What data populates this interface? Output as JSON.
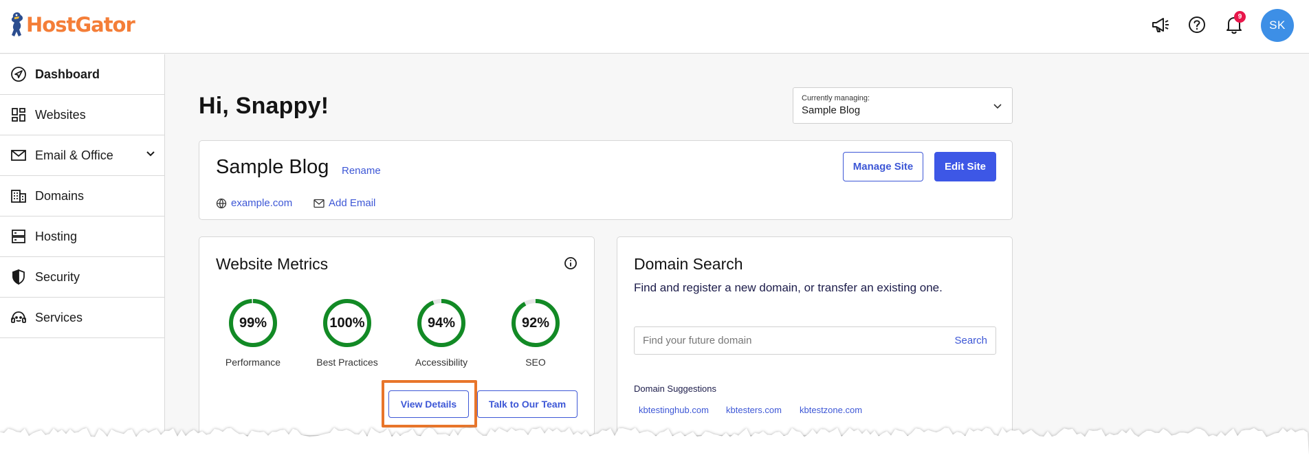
{
  "brand": {
    "name": "HostGator",
    "color": "#f47e38"
  },
  "header": {
    "icons": [
      "megaphone-icon",
      "help-icon",
      "bell-icon"
    ],
    "notification_count": "9",
    "avatar_initials": "SK",
    "avatar_color": "#3d8fe6"
  },
  "sidebar": {
    "items": [
      {
        "label": "Dashboard",
        "icon": "compass-icon",
        "active": true
      },
      {
        "label": "Websites",
        "icon": "grid-icon"
      },
      {
        "label": "Email & Office",
        "icon": "mail-icon",
        "expandable": true
      },
      {
        "label": "Domains",
        "icon": "building-icon"
      },
      {
        "label": "Hosting",
        "icon": "server-icon"
      },
      {
        "label": "Security",
        "icon": "shield-icon"
      },
      {
        "label": "Services",
        "icon": "support-icon"
      }
    ]
  },
  "main": {
    "greeting": "Hi, Snappy!",
    "managing": {
      "label": "Currently managing:",
      "value": "Sample Blog"
    },
    "site": {
      "title": "Sample Blog",
      "rename_label": "Rename",
      "domain_link": "example.com",
      "add_email_label": "Add Email",
      "manage_button": "Manage Site",
      "edit_button": "Edit Site"
    },
    "metrics": {
      "title": "Website Metrics",
      "items": [
        {
          "label": "Performance",
          "value": "99%",
          "fraction": 0.99
        },
        {
          "label": "Best Practices",
          "value": "100%",
          "fraction": 1.0
        },
        {
          "label": "Accessibility",
          "value": "94%",
          "fraction": 0.94
        },
        {
          "label": "SEO",
          "value": "92%",
          "fraction": 0.92
        }
      ],
      "ring_color": "#128a25",
      "view_details_button": "View Details",
      "talk_button": "Talk to Our Team"
    },
    "domain_search": {
      "title": "Domain Search",
      "description": "Find and register a new domain, or transfer an existing one.",
      "placeholder": "Find your future domain",
      "search_label": "Search",
      "suggestions_label": "Domain Suggestions",
      "suggestions": [
        "kbtestinghub.com",
        "kbtesters.com",
        "kbtestzone.com"
      ]
    }
  },
  "colors": {
    "accent": "#3d57e6",
    "highlight": "#e8752a"
  }
}
